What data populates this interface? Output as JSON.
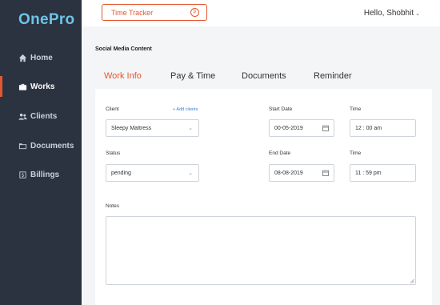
{
  "app": {
    "logo": "OnePro"
  },
  "sidebar": {
    "items": [
      {
        "label": "Home",
        "icon": "home-icon"
      },
      {
        "label": "Works",
        "icon": "briefcase-icon",
        "active": true
      },
      {
        "label": "Clients",
        "icon": "users-icon"
      },
      {
        "label": "Documents",
        "icon": "folder-icon"
      },
      {
        "label": "Billings",
        "icon": "billing-icon"
      }
    ]
  },
  "header": {
    "tracker_label": "Time Tracker",
    "tracker_icon_glyph": "P",
    "greeting": "Hello, Shobhit",
    "greeting_chevron": "⌄"
  },
  "main": {
    "section_title": "Social Media Content",
    "tabs": [
      {
        "label": "Work Info",
        "active": true
      },
      {
        "label": "Pay & Time"
      },
      {
        "label": "Documents"
      },
      {
        "label": "Reminder"
      }
    ],
    "form": {
      "client_label": "Client",
      "add_clients_label": "+ Add clients",
      "client_value": "Sleepy Mattress",
      "status_label": "Status",
      "status_value": "pending",
      "start_date_label": "Start Date",
      "start_date_value": "00-05-2019",
      "start_time_label": "Time",
      "start_time_value": "12 : 00 am",
      "end_date_label": "End Date",
      "end_date_value": "08-08-2019",
      "end_time_label": "Time",
      "end_time_value": "11 : 59 pm",
      "notes_label": "Notes",
      "notes_value": ""
    }
  },
  "colors": {
    "accent": "#e4572e",
    "sidebar": "#2b3240",
    "logo": "#6cc5e8",
    "link": "#3a7bd5"
  }
}
